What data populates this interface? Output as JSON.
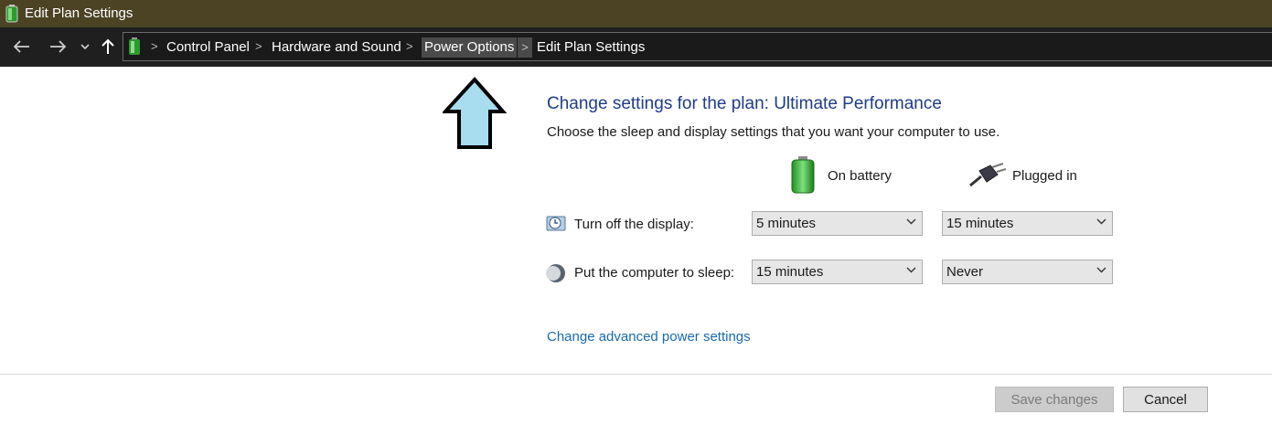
{
  "window": {
    "title": "Edit Plan Settings"
  },
  "nav": {
    "back_icon": "arrow-left-icon",
    "forward_icon": "arrow-right-icon",
    "recent_icon": "chevron-down-icon",
    "up_icon": "arrow-up-icon",
    "breadcrumbs": [
      "Control Panel",
      "Hardware and Sound",
      "Power Options",
      "Edit Plan Settings"
    ],
    "hovered_crumb": "Power Options"
  },
  "main": {
    "heading": "Change settings for the plan: Ultimate Performance",
    "subheading": "Choose the sleep and display settings that you want your computer to use.",
    "columns": {
      "battery": "On battery",
      "plugged": "Plugged in"
    },
    "rows": [
      {
        "label": "Turn off the display:",
        "icon": "display-timer-icon",
        "battery": "5 minutes",
        "plugged": "15 minutes"
      },
      {
        "label": "Put the computer to sleep:",
        "icon": "sleep-moon-icon",
        "battery": "15 minutes",
        "plugged": "Never"
      }
    ],
    "advanced_link": "Change advanced power settings"
  },
  "footer": {
    "save_label": "Save changes",
    "cancel_label": "Cancel",
    "save_enabled": false
  },
  "annotation": {
    "icon": "up-arrow-annotation",
    "color": "#a8dcef"
  },
  "colors": {
    "titlebar": "#4b4324",
    "heading": "#1e3d87",
    "link": "#1a6ab0"
  }
}
